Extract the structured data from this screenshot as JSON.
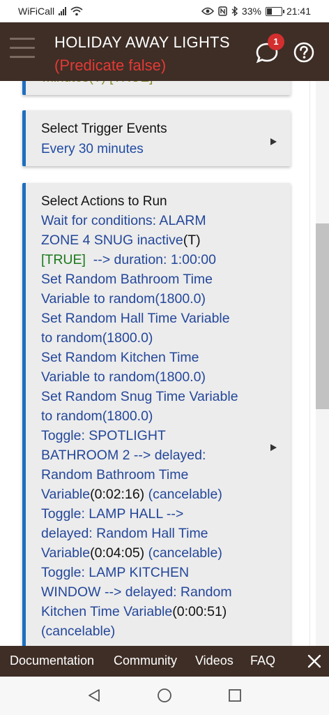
{
  "status_bar": {
    "carrier": "WiFiCall",
    "battery_percent": "33%",
    "time": "21:41"
  },
  "app_bar": {
    "title": "HOLIDAY AWAY LIGHTS",
    "subtitle": "(Predicate false)",
    "notification_count": "1"
  },
  "cards": {
    "top_partial": "minutes(T) [TRUE]",
    "trigger": {
      "label": "Select Trigger Events",
      "value": "Every 30 minutes"
    },
    "actions": {
      "label": "Select Actions to Run",
      "lines": [
        "Wait for conditions: ALARM",
        "ZONE 4 SNUG inactive",
        "(T)",
        "[TRUE]",
        "--> duration: 1:00:00",
        "Set Random Bathroom Time",
        "Variable to random(1800.0)",
        "Set Random Hall Time Variable",
        "to random(1800.0)",
        "Set Random Kitchen Time",
        "Variable to random(1800.0)",
        "Set Random Snug Time Variable",
        "to random(1800.0)",
        "Toggle: SPOTLIGHT",
        "BATHROOM 2 --> delayed:",
        "Random Bathroom Time",
        "Variable",
        "(0:02:16)",
        "(cancelable)",
        "Toggle: LAMP HALL -->",
        "delayed: Random Hall Time",
        "Variable",
        "(0:04:05)",
        "(cancelable)",
        "Toggle: LAMP KITCHEN",
        "WINDOW --> delayed: Random",
        "Kitchen Time Variable",
        "(0:00:51)",
        "(cancelable)"
      ]
    }
  },
  "bottom_bar": {
    "documentation": "Documentation",
    "community": "Community",
    "videos": "Videos",
    "faq": "FAQ"
  },
  "colors": {
    "app_bar_bg": "#3e2e26",
    "accent_blue": "#1e6fc0",
    "link_blue": "#24479a",
    "error_red": "#e53935",
    "true_green": "#1b7a1b"
  }
}
